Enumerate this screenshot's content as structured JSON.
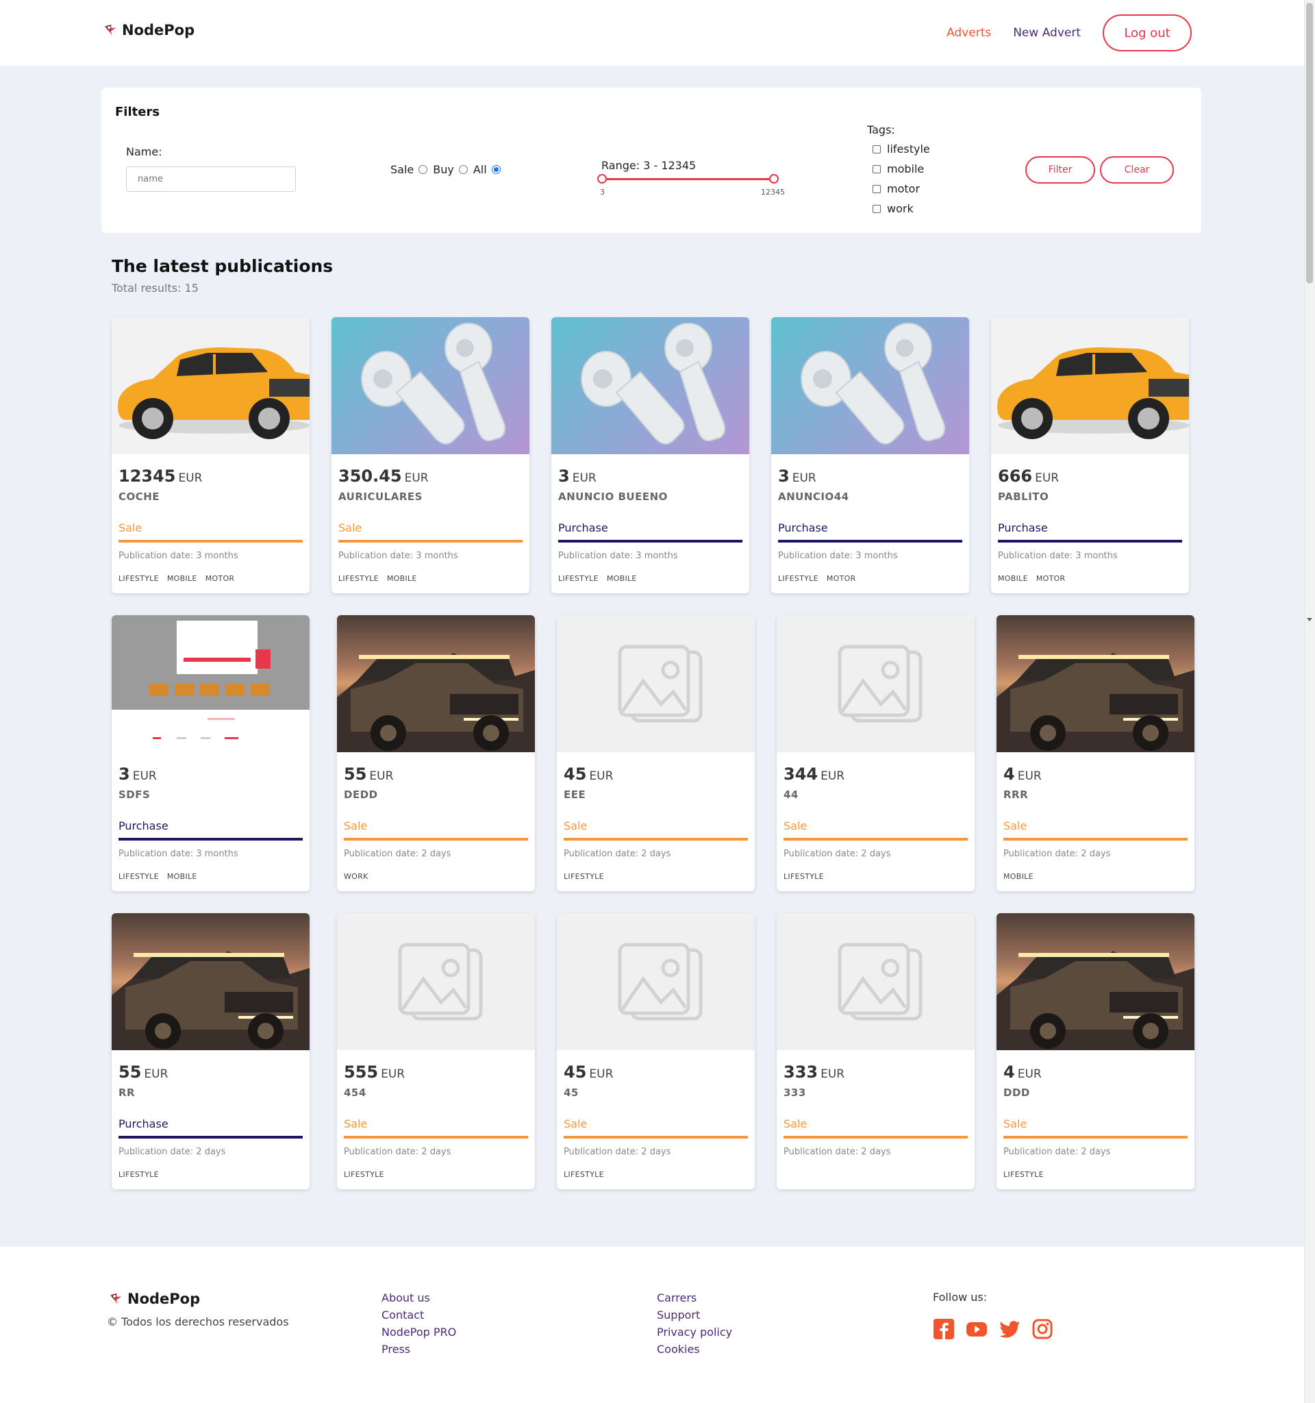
{
  "header": {
    "brand": "NodePop",
    "nav": {
      "adverts": "Adverts",
      "new_advert": "New Advert",
      "logout": "Log out"
    }
  },
  "filters": {
    "title": "Filters",
    "name_label": "Name:",
    "name_value": "",
    "name_placeholder": "name",
    "type_options": [
      "Sale",
      "Buy",
      "All"
    ],
    "type_selected": "All",
    "range_label": "Range: 3 - 12345",
    "range_min": "3",
    "range_max": "12345",
    "tags_label": "Tags:",
    "tags": [
      "lifestyle",
      "mobile",
      "motor",
      "work"
    ],
    "filter_button": "Filter",
    "clear_button": "Clear"
  },
  "main": {
    "title": "The latest publications",
    "total": "Total results: 15",
    "currency": "EUR",
    "adverts": [
      {
        "price": "12345",
        "name": "COCHE",
        "type": "Sale",
        "date": "Publication date: 3 months",
        "tags": [
          "LIFESTYLE",
          "MOBILE",
          "MOTOR"
        ],
        "image": "car"
      },
      {
        "price": "350.45",
        "name": "AURICULARES",
        "type": "Sale",
        "date": "Publication date: 3 months",
        "tags": [
          "LIFESTYLE",
          "MOBILE"
        ],
        "image": "earbuds"
      },
      {
        "price": "3",
        "name": "ANUNCIO BUEENO",
        "type": "Purchase",
        "date": "Publication date: 3 months",
        "tags": [
          "LIFESTYLE",
          "MOBILE"
        ],
        "image": "earbuds"
      },
      {
        "price": "3",
        "name": "ANUNCIO44",
        "type": "Purchase",
        "date": "Publication date: 3 months",
        "tags": [
          "LIFESTYLE",
          "MOTOR"
        ],
        "image": "earbuds"
      },
      {
        "price": "666",
        "name": "PABLITO",
        "type": "Purchase",
        "date": "Publication date: 3 months",
        "tags": [
          "MOBILE",
          "MOTOR"
        ],
        "image": "car"
      },
      {
        "price": "3",
        "name": "SDFS",
        "type": "Purchase",
        "date": "Publication date: 3 months",
        "tags": [
          "LIFESTYLE",
          "MOBILE"
        ],
        "image": "screenshot"
      },
      {
        "price": "55",
        "name": "DEDD",
        "type": "Sale",
        "date": "Publication date: 2 days",
        "tags": [
          "WORK"
        ],
        "image": "truck"
      },
      {
        "price": "45",
        "name": "EEE",
        "type": "Sale",
        "date": "Publication date: 2 days",
        "tags": [
          "LIFESTYLE"
        ],
        "image": "placeholder"
      },
      {
        "price": "344",
        "name": "44",
        "type": "Sale",
        "date": "Publication date: 2 days",
        "tags": [
          "LIFESTYLE"
        ],
        "image": "placeholder"
      },
      {
        "price": "4",
        "name": "RRR",
        "type": "Sale",
        "date": "Publication date: 2 days",
        "tags": [
          "MOBILE"
        ],
        "image": "truck"
      },
      {
        "price": "55",
        "name": "RR",
        "type": "Purchase",
        "date": "Publication date: 2 days",
        "tags": [
          "LIFESTYLE"
        ],
        "image": "truck"
      },
      {
        "price": "555",
        "name": "454",
        "type": "Sale",
        "date": "Publication date: 2 days",
        "tags": [
          "LIFESTYLE"
        ],
        "image": "placeholder"
      },
      {
        "price": "45",
        "name": "45",
        "type": "Sale",
        "date": "Publication date: 2 days",
        "tags": [
          "LIFESTYLE"
        ],
        "image": "placeholder"
      },
      {
        "price": "333",
        "name": "333",
        "type": "Sale",
        "date": "Publication date: 2 days",
        "tags": [],
        "image": "placeholder"
      },
      {
        "price": "4",
        "name": "DDD",
        "type": "Sale",
        "date": "Publication date: 2 days",
        "tags": [
          "LIFESTYLE"
        ],
        "image": "truck"
      }
    ]
  },
  "footer": {
    "brand": "NodePop",
    "rights": "© Todos los derechos reservados",
    "links_col1": [
      "About us",
      "Contact",
      "NodePop PRO",
      "Press"
    ],
    "links_col2": [
      "Carrers",
      "Support",
      "Privacy policy",
      "Cookies"
    ],
    "follow": "Follow us:",
    "socials": [
      "facebook-icon",
      "youtube-icon",
      "twitter-icon",
      "instagram-icon"
    ]
  },
  "colors": {
    "accent": "#e8364b",
    "nav_active": "#f2552c",
    "link": "#4a2a7a",
    "sale": "#f7963b",
    "purchase": "#1d1660",
    "background": "#eef0f8"
  }
}
